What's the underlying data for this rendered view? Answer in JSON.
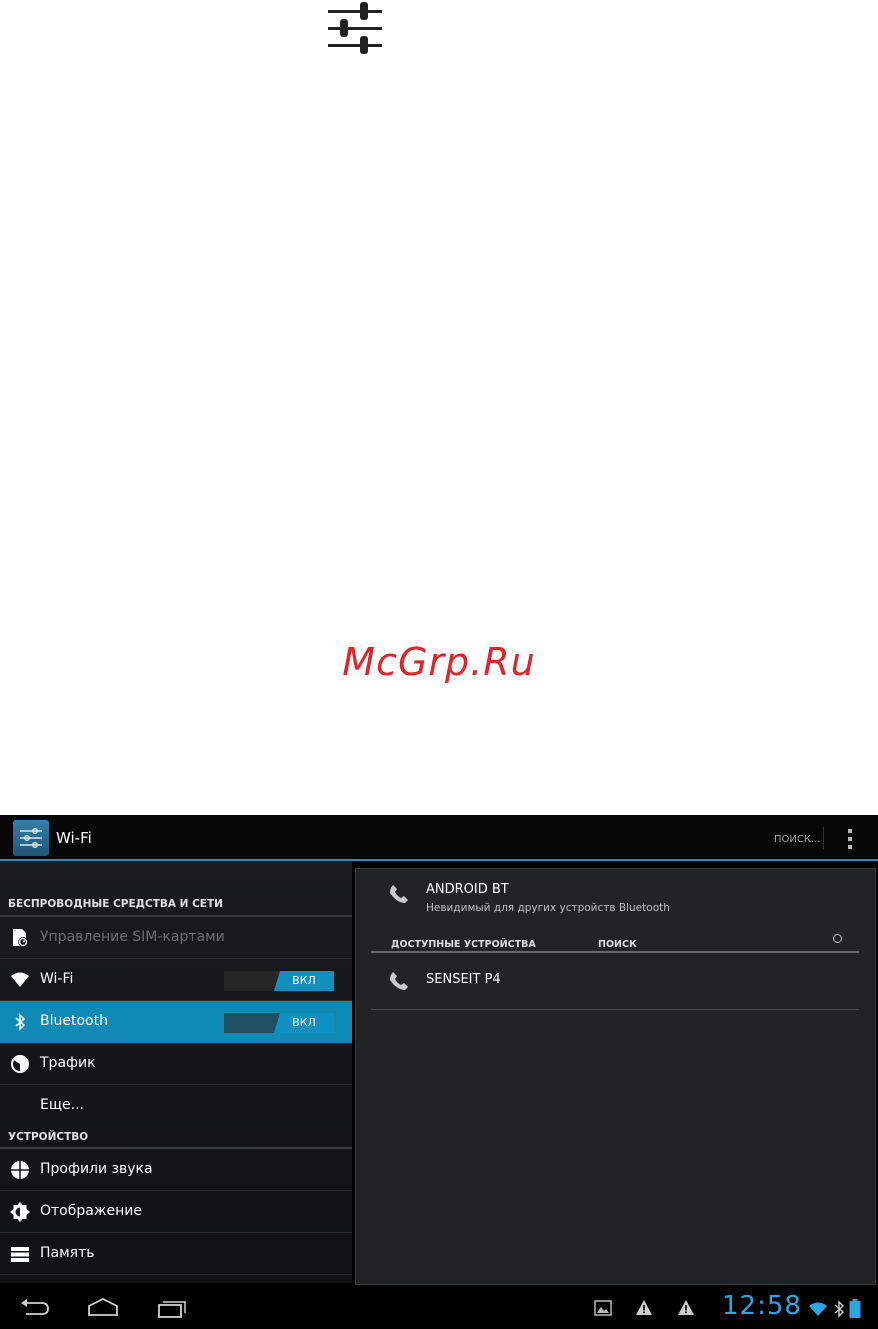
{
  "page": {
    "watermark": "McGrp.Ru"
  },
  "actionbar": {
    "title": "Wi-Fi",
    "search_label": "ПОИСК..."
  },
  "sidebar": {
    "section_wireless": "БЕСПРОВОДНЫЕ СРЕДСТВА И СЕТИ",
    "section_device": "УСТРОЙСТВО",
    "items": [
      {
        "label": "Управление SIM-картами",
        "icon": "sim-icon",
        "disabled": true
      },
      {
        "label": "Wi-Fi",
        "icon": "wifi-icon",
        "toggle": "ВКЛ"
      },
      {
        "label": "Bluetooth",
        "icon": "bluetooth-icon",
        "toggle": "ВКЛ",
        "selected": true
      },
      {
        "label": "Трафик",
        "icon": "data-usage-icon"
      },
      {
        "label": "Еще..."
      },
      {
        "label": "Профили звука",
        "icon": "sound-icon"
      },
      {
        "label": "Отображение",
        "icon": "display-icon"
      },
      {
        "label": "Память",
        "icon": "storage-icon"
      }
    ]
  },
  "bluetooth": {
    "device_name": "ANDROID BT",
    "device_status": "Невидимый для других устройств Bluetooth",
    "available_header": "ДОСТУПНЫЕ УСТРОЙСТВА",
    "search_header": "ПОИСК",
    "found_devices": [
      {
        "name": "SENSEIT P4",
        "icon": "phone-icon"
      }
    ]
  },
  "statusbar": {
    "time": "12:58"
  },
  "colors": {
    "accent": "#0e8ab5",
    "clock": "#2aa6e0",
    "watermark": "#e0242b"
  }
}
